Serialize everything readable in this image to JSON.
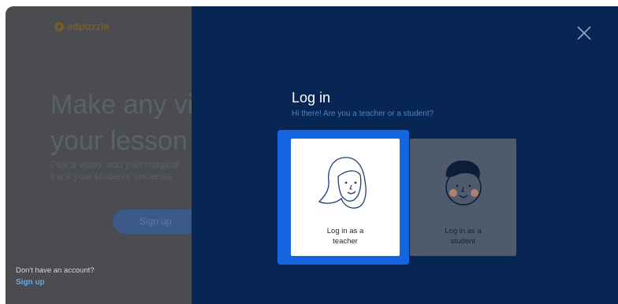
{
  "background_page": {
    "logo_text": "edpuzzle",
    "hero_line1": "Make any vid",
    "hero_line2": "your lesson",
    "hero_sub1": "Pick a video, add your magical",
    "hero_sub2": "track your students' understa",
    "hero_button": "Sign up",
    "no_account_text": "Don't have an account?",
    "signup_link": "Sign up"
  },
  "modal": {
    "title": "Log in",
    "subtitle": "Hi there! Are you a teacher or a student?",
    "teacher_card": {
      "line1": "Log in as a",
      "line2": "teacher",
      "selected": true
    },
    "student_card": {
      "line1": "Log in as a",
      "line2": "student",
      "selected": false
    },
    "close_icon": "close-icon"
  },
  "colors": {
    "modal_bg": "#072653",
    "selected_border": "#1565e0",
    "overlay_left": "#4a4c50"
  }
}
